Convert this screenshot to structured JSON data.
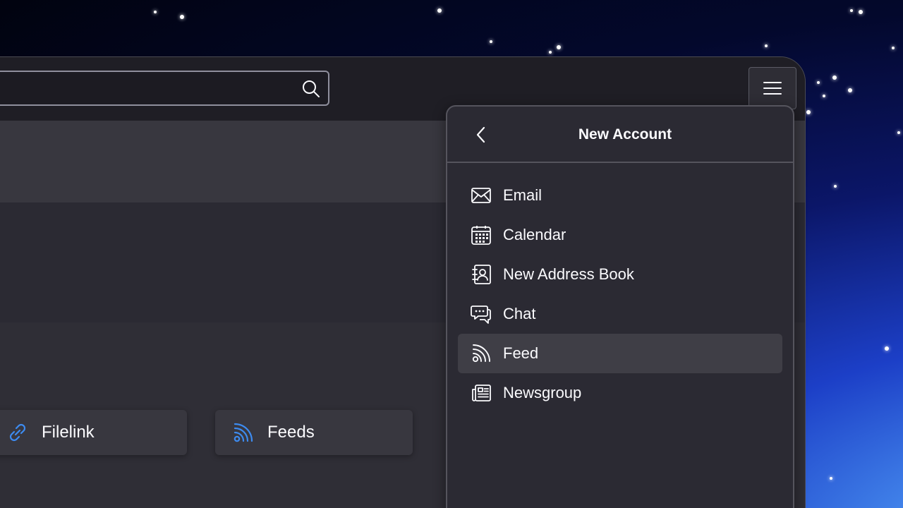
{
  "search": {
    "value": "",
    "placeholder": ""
  },
  "toolbar": {
    "menu_icon": "hamburger-menu-icon"
  },
  "cards": [
    {
      "label": "Filelink",
      "icon": "link-icon",
      "icon_color": "#3d8bf0"
    },
    {
      "label": "Feeds",
      "icon": "rss-icon",
      "icon_color": "#3d8bf0"
    }
  ],
  "panel": {
    "title": "New Account",
    "back_icon": "chevron-left-icon",
    "items": [
      {
        "label": "Email",
        "icon": "envelope-icon"
      },
      {
        "label": "Calendar",
        "icon": "calendar-icon"
      },
      {
        "label": "New Address Book",
        "icon": "address-book-icon"
      },
      {
        "label": "Chat",
        "icon": "chat-bubbles-icon"
      },
      {
        "label": "Feed",
        "icon": "rss-icon",
        "highlighted": true
      },
      {
        "label": "Newsgroup",
        "icon": "newspaper-icon"
      }
    ]
  },
  "colors": {
    "accent": "#3d8bf0",
    "panel_bg": "#2b2a33",
    "hover_bg": "#3f3e46"
  }
}
